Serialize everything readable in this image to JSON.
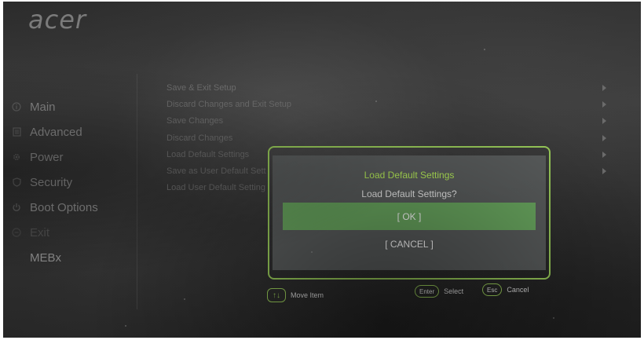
{
  "brand": {
    "logo_text": "acer"
  },
  "nav": {
    "items": [
      {
        "label": "Main",
        "icon": "info-icon"
      },
      {
        "label": "Advanced",
        "icon": "document-icon"
      },
      {
        "label": "Power",
        "icon": "gear-icon"
      },
      {
        "label": "Security",
        "icon": "shield-icon"
      },
      {
        "label": "Boot Options",
        "icon": "power-icon"
      },
      {
        "label": "Exit",
        "icon": "exit-icon"
      },
      {
        "label": "MEBx"
      }
    ]
  },
  "menu": {
    "items": [
      {
        "label": "Save & Exit Setup"
      },
      {
        "label": "Discard Changes and Exit Setup"
      },
      {
        "label": "Save Changes"
      },
      {
        "label": "Discard Changes"
      },
      {
        "label": "Load Default Settings"
      },
      {
        "label": "Save as User Default Sett"
      },
      {
        "label": "Load User Default Setting"
      }
    ]
  },
  "dialog": {
    "title": "Load Default Settings",
    "question": "Load Default Settings?",
    "ok_label": "[ OK ]",
    "cancel_label": "[ CANCEL ]"
  },
  "hints": {
    "move_label": "Move Item",
    "enter_key": "Enter",
    "enter_label": "Select",
    "esc_key": "Esc",
    "esc_label": "Cancel"
  },
  "colors": {
    "accent": "#9acd5a",
    "ok_highlight": "#6aa860",
    "title_green": "#b7ee5a"
  }
}
